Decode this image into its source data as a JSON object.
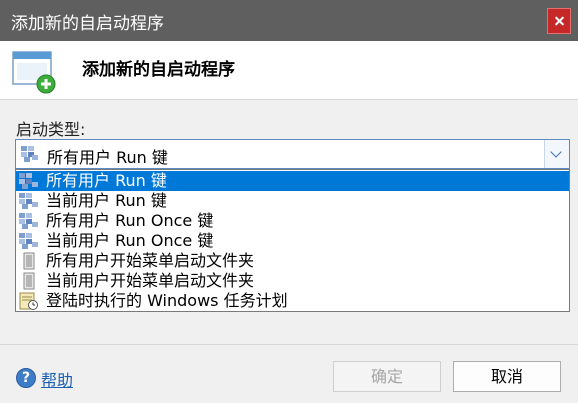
{
  "window": {
    "title": "添加新的自启动程序"
  },
  "header": {
    "title": "添加新的自启动程序",
    "icon": "add-program-window-icon"
  },
  "form": {
    "type_label": "启动类型:",
    "selected": "所有用户 Run 键",
    "options": [
      {
        "label": "所有用户 Run 键",
        "icon": "registry-icon",
        "selected": true
      },
      {
        "label": "当前用户 Run 键",
        "icon": "registry-icon"
      },
      {
        "label": "所有用户 Run Once 键",
        "icon": "registry-icon"
      },
      {
        "label": "当前用户 Run Once 键",
        "icon": "registry-icon"
      },
      {
        "label": "所有用户开始菜单启动文件夹",
        "icon": "startup-folder-icon"
      },
      {
        "label": "当前用户开始菜单启动文件夹",
        "icon": "startup-folder-icon"
      },
      {
        "label": "登陆时执行的 Windows 任务计划",
        "icon": "task-scheduler-icon"
      }
    ]
  },
  "footer": {
    "help_label": "帮助",
    "ok_label": "确定",
    "cancel_label": "取消"
  },
  "colors": {
    "titlebar": "#5f5f5f",
    "selection": "#0078d7",
    "link": "#1a5fb4",
    "close": "#c62828"
  }
}
